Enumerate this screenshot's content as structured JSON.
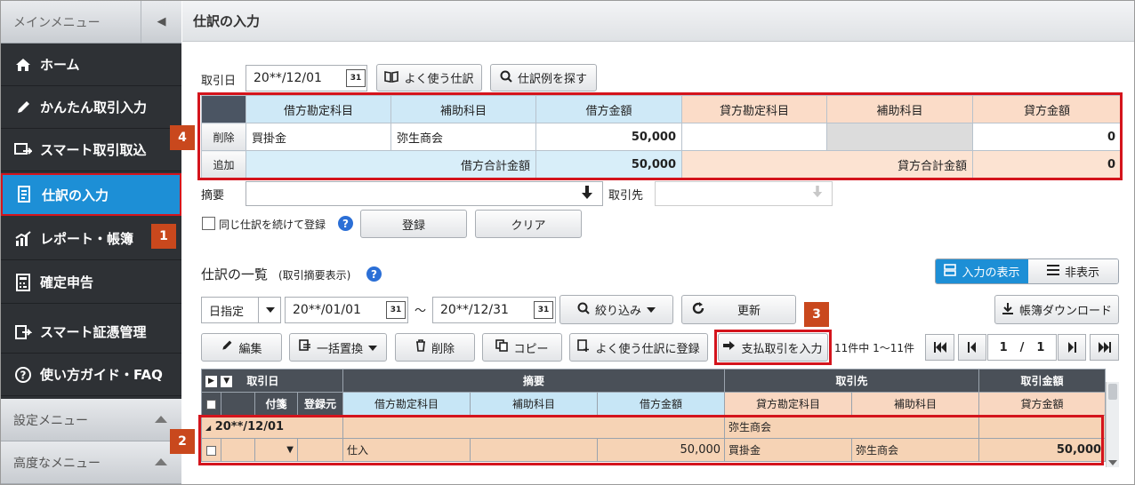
{
  "sidebar": {
    "menu_title": "メインメニュー",
    "collapse_icon": "◀",
    "items": [
      {
        "label": "ホーム",
        "icon": "home-icon"
      },
      {
        "label": "かんたん取引入力",
        "icon": "pencil-icon"
      },
      {
        "label": "スマート取引取込",
        "icon": "import-icon"
      },
      {
        "label": "仕訳の入力",
        "icon": "journal-icon",
        "active": true
      },
      {
        "label": "レポート・帳簿",
        "icon": "report-icon"
      },
      {
        "label": "確定申告",
        "icon": "calculator-icon"
      },
      {
        "label": "スマート証憑管理",
        "icon": "document-icon"
      },
      {
        "label": "使い方ガイド・FAQ",
        "icon": "help-icon"
      }
    ],
    "settings_menu": "設定メニュー",
    "advanced_menu": "高度なメニュー"
  },
  "header": {
    "title": "仕訳の入力"
  },
  "form": {
    "date_label": "取引日",
    "date_value": "20**/12/01",
    "calendar_text": "31",
    "frequent_button": "よく使う仕訳",
    "search_example_button": "仕訳例を探す",
    "summary_label": "摘要",
    "partner_label": "取引先",
    "repeat_label": "同じ仕訳を続けて登録",
    "register_button": "登録",
    "clear_button": "クリア"
  },
  "entry_table": {
    "headers": [
      "借方勘定科目",
      "補助科目",
      "借方金額",
      "貸方勘定科目",
      "補助科目",
      "貸方金額"
    ],
    "delete_button": "削除",
    "add_button": "追加",
    "row": {
      "debit_account": "買掛金",
      "debit_sub": "弥生商会",
      "debit_amount": "50,000",
      "credit_account": "",
      "credit_sub": "",
      "credit_amount": "0"
    },
    "debit_total_label": "借方合計金額",
    "debit_total": "50,000",
    "credit_total_label": "貸方合計金額",
    "credit_total": "0"
  },
  "list": {
    "title": "仕訳の一覧",
    "subtitle": "(取引摘要表示)",
    "view_input": "入力の表示",
    "view_hide": "非表示",
    "date_mode": "日指定",
    "from_date": "20**/01/01",
    "tilde": "～",
    "to_date": "20**/12/31",
    "filter_button": "絞り込み",
    "refresh_button": "更新",
    "download_button": "帳簿ダウンロード",
    "edit_button": "編集",
    "bulk_replace_button": "一括置換",
    "delete_button": "削除",
    "copy_button": "コピー",
    "register_frequent_button": "よく使う仕訳に登録",
    "payment_button": "支払取引を入力",
    "count_text": "11件中 1〜11件",
    "page_current": "1",
    "page_sep": "/",
    "page_total": "1",
    "col_date": "取引日",
    "col_summary": "摘要",
    "col_partner": "取引先",
    "col_amount": "取引金額",
    "col_tag": "付箋",
    "col_source": "登録元",
    "col_debit_account": "借方勘定科目",
    "col_debit_sub": "補助科目",
    "col_debit_amount": "借方金額",
    "col_credit_account": "貸方勘定科目",
    "col_credit_sub": "補助科目",
    "col_credit_amount": "貸方金額",
    "group_date": "20**/12/01",
    "group_partner": "弥生商会",
    "row": {
      "debit_account": "仕入",
      "debit_sub": "",
      "debit_amount": "50,000",
      "credit_account": "買掛金",
      "credit_sub": "弥生商会",
      "credit_amount": "50,000"
    }
  },
  "badges": [
    "1",
    "2",
    "3",
    "4"
  ],
  "colors": {
    "accent": "#1d8fd6",
    "highlight": "#d4141c",
    "badge": "#c9481d",
    "debit": "#cfe9f7",
    "credit": "#fbdcc8"
  }
}
